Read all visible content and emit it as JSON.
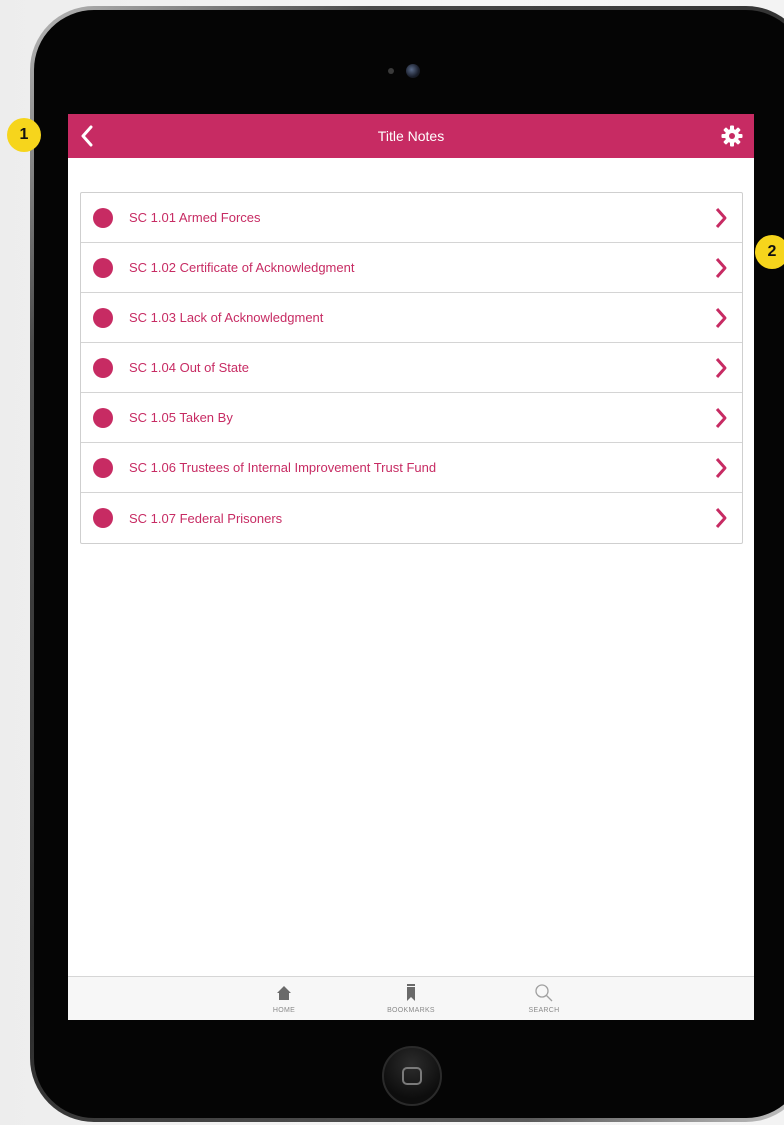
{
  "header": {
    "title": "Title Notes",
    "back_icon": "chevron-left-icon",
    "settings_icon": "gear-icon"
  },
  "items": [
    {
      "label": "SC 1.01 Armed Forces"
    },
    {
      "label": "SC 1.02 Certificate of Acknowledgment"
    },
    {
      "label": "SC 1.03 Lack of Acknowledgment"
    },
    {
      "label": "SC 1.04 Out of State"
    },
    {
      "label": "SC 1.05 Taken By"
    },
    {
      "label": "SC 1.06 Trustees of Internal Improvement Trust Fund"
    },
    {
      "label": "SC 1.07 Federal Prisoners"
    }
  ],
  "tabbar": {
    "home": {
      "label": "HOME",
      "icon": "home-icon"
    },
    "bookmarks": {
      "label": "BOOKMARKS",
      "icon": "bookmark-icon"
    },
    "search": {
      "label": "SEARCH",
      "icon": "search-icon"
    }
  },
  "callouts": {
    "one": "1",
    "two": "2"
  },
  "colors": {
    "accent": "#c72b63",
    "badge": "#f6d51c"
  }
}
